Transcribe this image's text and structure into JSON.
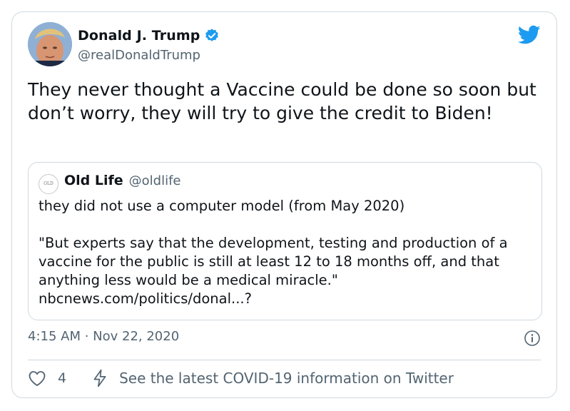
{
  "author": {
    "name": "Donald J. Trump",
    "handle": "@realDonaldTrump",
    "verified": true
  },
  "tweet": {
    "text": "They never thought a Vaccine could be done so soon but don’t worry, they will try to give the credit to Biden!",
    "timestamp": "4:15 AM · Nov 22, 2020"
  },
  "quoted_tweet": {
    "avatar_text": "OLD LIFE",
    "name": "Old Life",
    "handle": "@oldlife",
    "text": "they did not use a computer model (from May 2020)\n\n\"But experts say that the development, testing and production of a vaccine for the public is still at least 12 to 18 months off, and that anything less would be a medical miracle.\"\nnbcnews.com/politics/donal...?"
  },
  "actions": {
    "like_count": "4",
    "covid_info": "See the latest COVID-19 information on Twitter"
  },
  "icons": {
    "verified": "verified-badge-icon",
    "logo": "twitter-bird-icon",
    "info": "info-icon",
    "like": "heart-icon",
    "covid": "lightning-bolt-icon"
  },
  "colors": {
    "brand_blue": "#1d9bf0",
    "text_primary": "#0f1419",
    "text_secondary": "#536471",
    "border": "#cfd9de"
  }
}
